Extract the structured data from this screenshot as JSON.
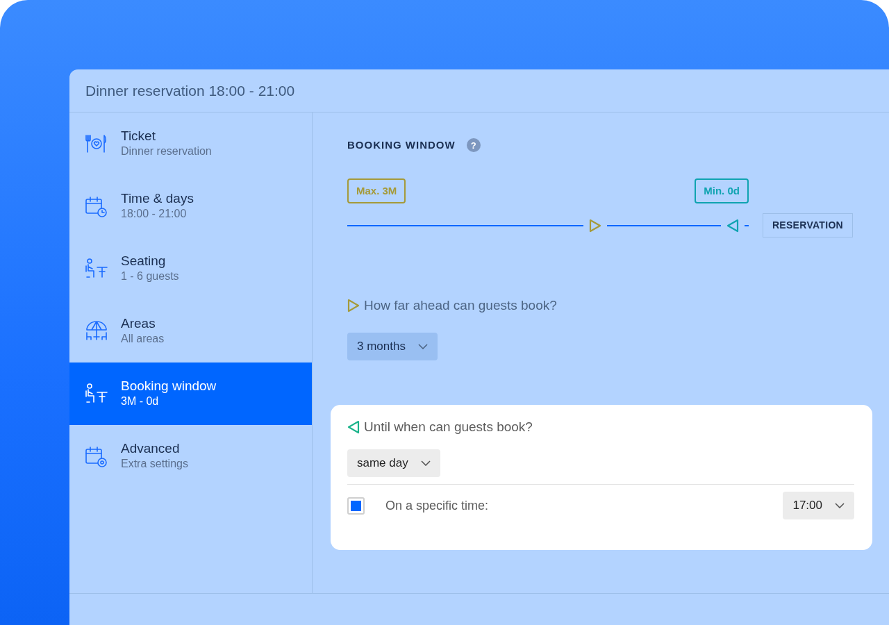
{
  "window": {
    "title": "Dinner reservation 18:00 - 21:00"
  },
  "sidebar": {
    "items": [
      {
        "title": "Ticket",
        "subtitle": "Dinner reservation",
        "selected": false
      },
      {
        "title": "Time & days",
        "subtitle": "18:00 - 21:00",
        "selected": false
      },
      {
        "title": "Seating",
        "subtitle": "1 - 6 guests",
        "selected": false
      },
      {
        "title": "Areas",
        "subtitle": "All areas",
        "selected": false
      },
      {
        "title": "Booking window",
        "subtitle": "3M - 0d",
        "selected": true
      },
      {
        "title": "Advanced",
        "subtitle": "Extra settings",
        "selected": false
      }
    ]
  },
  "section": {
    "title": "BOOKING WINDOW",
    "help": "?"
  },
  "timeline": {
    "max_label": "Max. 3M",
    "min_label": "Min. 0d",
    "end_label": "RESERVATION"
  },
  "ahead": {
    "question": "How far ahead can guests book?",
    "value": "3 months"
  },
  "until": {
    "question": "Until when can guests book?",
    "value": "same day",
    "specific_time": {
      "label": "On a specific time:",
      "checked": true,
      "value": "17:00"
    }
  }
}
